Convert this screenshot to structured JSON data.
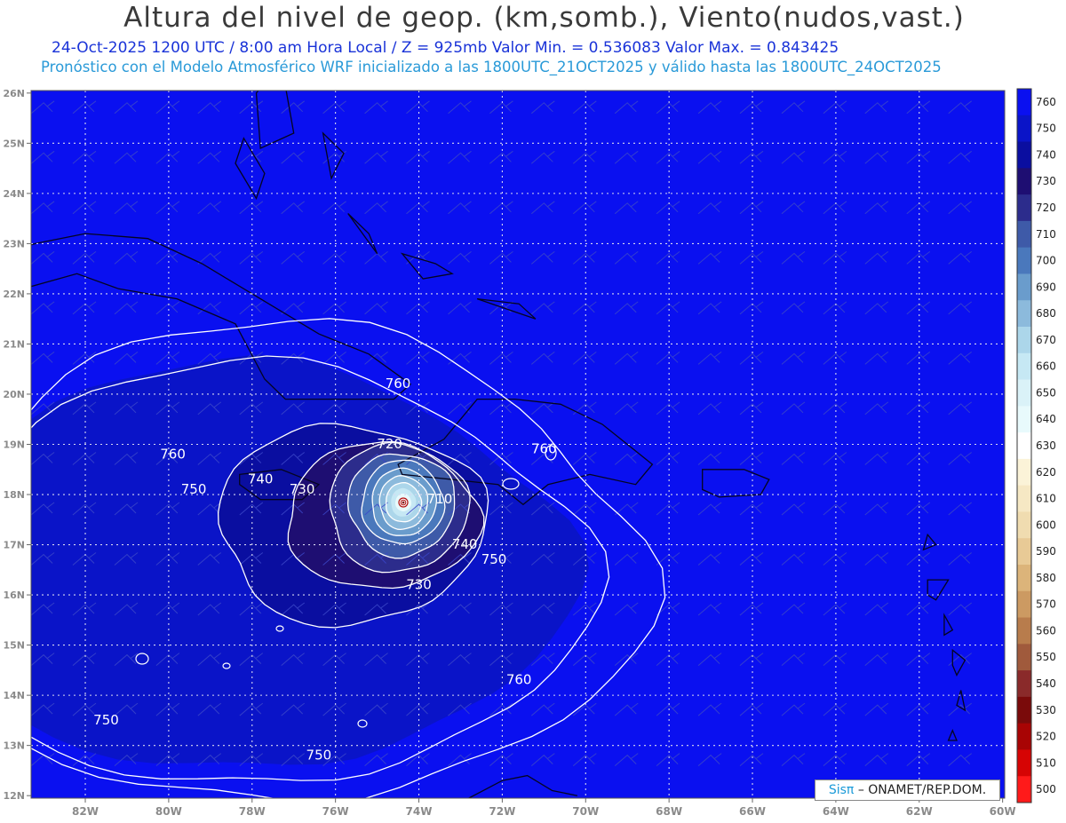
{
  "header": {
    "title": "Altura del nivel de geop. (km,somb.), Viento(nudos,vast.)",
    "subtitle1": "24-Oct-2025   1200 UTC / 8:00 am Hora Local / Z = 925mb   Valor Min. = 0.536083   Valor Max. = 0.843425",
    "subtitle2": "Pronóstico con el Modelo Atmosférico WRF inicializado a las 1800UTC_21OCT2025 y válido hasta las  1800UTC_24OCT2025"
  },
  "map": {
    "lon_labels": [
      "82W",
      "80W",
      "78W",
      "76W",
      "74W",
      "72W",
      "70W",
      "68W",
      "66W",
      "64W",
      "62W",
      "60W"
    ],
    "lat_labels": [
      "26N",
      "25N",
      "24N",
      "23N",
      "22N",
      "21N",
      "20N",
      "19N",
      "18N",
      "17N",
      "16N",
      "15N",
      "14N",
      "13N",
      "12N"
    ],
    "background_color": "#0a10f0",
    "contour_labels": [
      {
        "text": "760",
        "lon": -74.5,
        "lat": 20.2
      },
      {
        "text": "760",
        "lon": -79.9,
        "lat": 18.8
      },
      {
        "text": "760",
        "lon": -71.0,
        "lat": 18.9
      },
      {
        "text": "760",
        "lon": -71.6,
        "lat": 14.3
      },
      {
        "text": "750",
        "lon": -79.4,
        "lat": 18.1
      },
      {
        "text": "750",
        "lon": -81.5,
        "lat": 13.5
      },
      {
        "text": "750",
        "lon": -76.4,
        "lat": 12.8
      },
      {
        "text": "750",
        "lon": -72.2,
        "lat": 16.7
      },
      {
        "text": "740",
        "lon": -77.8,
        "lat": 18.3
      },
      {
        "text": "740",
        "lon": -72.9,
        "lat": 17.0
      },
      {
        "text": "730",
        "lon": -76.8,
        "lat": 18.1
      },
      {
        "text": "730",
        "lon": -74.0,
        "lat": 16.2
      },
      {
        "text": "720",
        "lon": -74.7,
        "lat": 19.0
      },
      {
        "text": "710",
        "lon": -73.5,
        "lat": 17.9
      }
    ]
  },
  "colorbar": {
    "levels": [
      {
        "label": "760",
        "color": "#0a10f0"
      },
      {
        "label": "750",
        "color": "#0a14c8"
      },
      {
        "label": "740",
        "color": "#0a0ea0"
      },
      {
        "label": "730",
        "color": "#1e0e72"
      },
      {
        "label": "720",
        "color": "#2c2c8c"
      },
      {
        "label": "710",
        "color": "#3e5aa8"
      },
      {
        "label": "700",
        "color": "#4a78bc"
      },
      {
        "label": "690",
        "color": "#6a9ccc"
      },
      {
        "label": "680",
        "color": "#8cbadc"
      },
      {
        "label": "670",
        "color": "#acd6ea"
      },
      {
        "label": "660",
        "color": "#c6e8f4"
      },
      {
        "label": "650",
        "color": "#daf2f8"
      },
      {
        "label": "640",
        "color": "#e8fafc"
      },
      {
        "label": "630",
        "color": "#ffffff"
      },
      {
        "label": "620",
        "color": "#fbf3d8"
      },
      {
        "label": "610",
        "color": "#f6e8c4"
      },
      {
        "label": "600",
        "color": "#f0dcb0"
      },
      {
        "label": "590",
        "color": "#e8ca96"
      },
      {
        "label": "580",
        "color": "#dcb47a"
      },
      {
        "label": "570",
        "color": "#cc9a62"
      },
      {
        "label": "560",
        "color": "#b87c4c"
      },
      {
        "label": "550",
        "color": "#a05a3c"
      },
      {
        "label": "540",
        "color": "#8a2a2a"
      },
      {
        "label": "530",
        "color": "#7a0a0a"
      },
      {
        "label": "520",
        "color": "#a80404"
      },
      {
        "label": "510",
        "color": "#d60404"
      },
      {
        "label": "500",
        "color": "#ff1a1a"
      }
    ]
  },
  "credit": {
    "sis": "Sisπ",
    "text": "– ONAMET/REP.DOM."
  }
}
